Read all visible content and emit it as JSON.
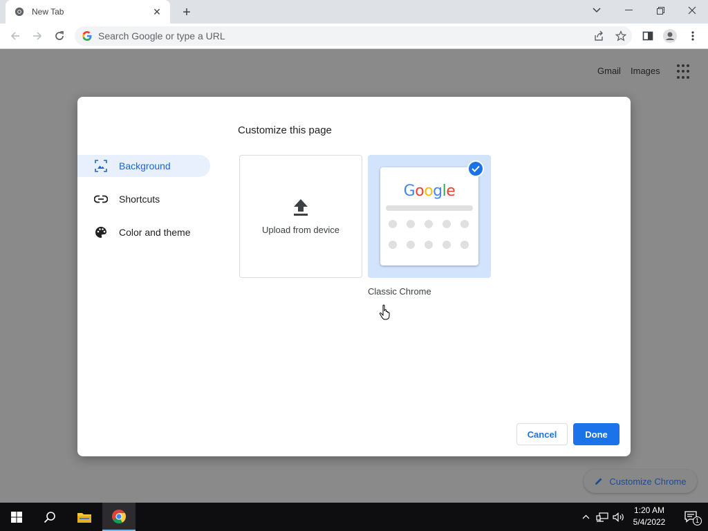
{
  "browser": {
    "tab_title": "New Tab",
    "omnibox_placeholder": "Search Google or type a URL"
  },
  "page": {
    "gmail_link": "Gmail",
    "images_link": "Images",
    "customize_chrome_label": "Customize Chrome"
  },
  "dialog": {
    "title": "Customize this page",
    "menu": [
      {
        "label": "Background",
        "icon": "image-icon",
        "active": true
      },
      {
        "label": "Shortcuts",
        "icon": "link-icon",
        "active": false
      },
      {
        "label": "Color and theme",
        "icon": "palette-icon",
        "active": false
      }
    ],
    "upload_label": "Upload from device",
    "classic_logo": "Google",
    "classic_caption": "Classic Chrome",
    "cancel_label": "Cancel",
    "done_label": "Done"
  },
  "taskbar": {
    "time": "1:20 AM",
    "date": "5/4/2022",
    "notification_count": "1"
  },
  "colors": {
    "accent": "#1a73e8",
    "active_menu_bg": "#e8f0fe",
    "taskbar": "#0e0e10"
  }
}
